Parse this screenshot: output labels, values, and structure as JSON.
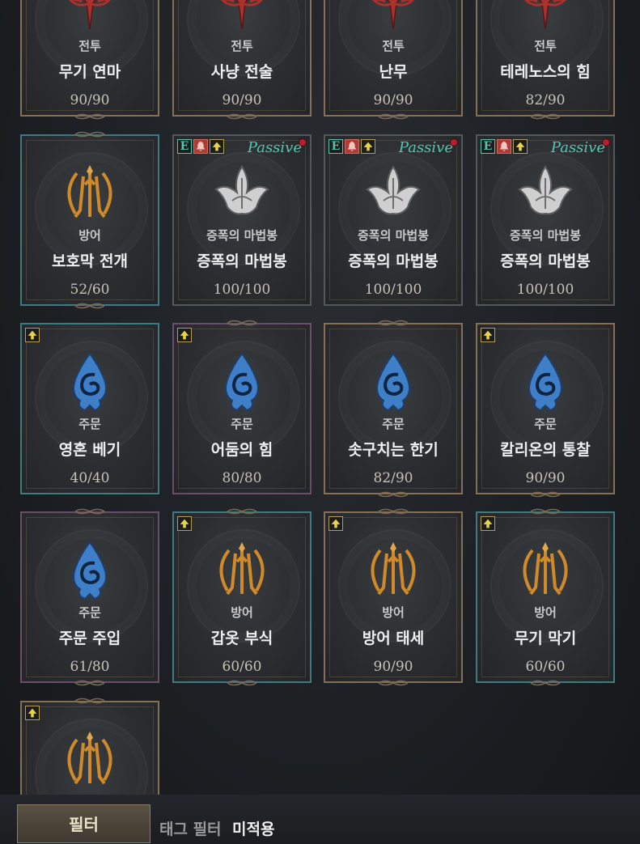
{
  "cards": [
    {
      "category": "전투",
      "name": "무기 연마",
      "rank": "90/90"
    },
    {
      "category": "전투",
      "name": "사냥 전술",
      "rank": "90/90"
    },
    {
      "category": "전투",
      "name": "난무",
      "rank": "90/90"
    },
    {
      "category": "전투",
      "name": "테레노스의 힘",
      "rank": "82/90"
    },
    {
      "category": "방어",
      "name": "보호막 전개",
      "rank": "52/60"
    },
    {
      "category": "증폭의 마법봉",
      "name": "증폭의 마법봉",
      "rank": "100/100",
      "passive": "Passive"
    },
    {
      "category": "증폭의 마법봉",
      "name": "증폭의 마법봉",
      "rank": "100/100",
      "passive": "Passive"
    },
    {
      "category": "증폭의 마법봉",
      "name": "증폭의 마법봉",
      "rank": "100/100",
      "passive": "Passive"
    },
    {
      "category": "주문",
      "name": "영혼 베기",
      "rank": "40/40"
    },
    {
      "category": "주문",
      "name": "어둠의 힘",
      "rank": "80/80"
    },
    {
      "category": "주문",
      "name": "솟구치는 한기",
      "rank": "82/90"
    },
    {
      "category": "주문",
      "name": "칼리온의 통찰",
      "rank": "90/90"
    },
    {
      "category": "주문",
      "name": "주문 주입",
      "rank": "61/80"
    },
    {
      "category": "방어",
      "name": "갑옷 부식",
      "rank": "60/60"
    },
    {
      "category": "방어",
      "name": "방어 태세",
      "rank": "90/90"
    },
    {
      "category": "방어",
      "name": "무기 막기",
      "rank": "60/60"
    },
    {
      "category": "방어",
      "name": "",
      "rank": ""
    }
  ],
  "badges": {
    "e_letter": "E"
  },
  "footer": {
    "filter_button": "필터",
    "tag_filter_label": "태그 필터",
    "tag_filter_value": "미적용"
  },
  "colors": {
    "passive_text": "#4fc9b4",
    "combat_icon": "#a8322d",
    "defense_icon": "#d08a2a",
    "spell_icon": "#3f7fc8",
    "amplify_icon": "#cfcfcf"
  },
  "icons": {
    "combat": "crimson-tree-icon",
    "defense": "golden-sword-wings-icon",
    "spell": "blue-spiral-flame-icon",
    "amplify": "silver-lotus-icon",
    "upgrade": "up-arrow-icon",
    "bell": "bell-icon"
  }
}
